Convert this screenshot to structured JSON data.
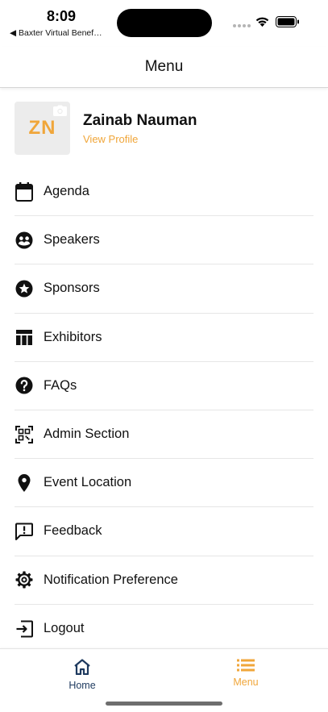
{
  "status_bar": {
    "time": "8:09",
    "back_app": "◀ Baxter Virtual Benef…"
  },
  "header": {
    "title": "Menu"
  },
  "profile": {
    "initials": "ZN",
    "name": "Zainab Nauman",
    "view_profile": "View Profile"
  },
  "menu": {
    "items": [
      {
        "label": "Agenda",
        "icon": "calendar-icon"
      },
      {
        "label": "Speakers",
        "icon": "speakers-icon"
      },
      {
        "label": "Sponsors",
        "icon": "star-icon"
      },
      {
        "label": "Exhibitors",
        "icon": "table-icon"
      },
      {
        "label": "FAQs",
        "icon": "question-icon"
      },
      {
        "label": "Admin Section",
        "icon": "qr-code-icon"
      },
      {
        "label": "Event Location",
        "icon": "location-pin-icon"
      },
      {
        "label": "Feedback",
        "icon": "feedback-icon"
      },
      {
        "label": "Notification Preference",
        "icon": "gear-icon"
      },
      {
        "label": "Logout",
        "icon": "logout-icon"
      }
    ]
  },
  "tabbar": {
    "home_label": "Home",
    "menu_label": "Menu",
    "active_tab": "Menu"
  },
  "colors": {
    "accent": "#f0a63a",
    "home_tab": "#1e3a5f",
    "divider": "#e6e6e6"
  }
}
